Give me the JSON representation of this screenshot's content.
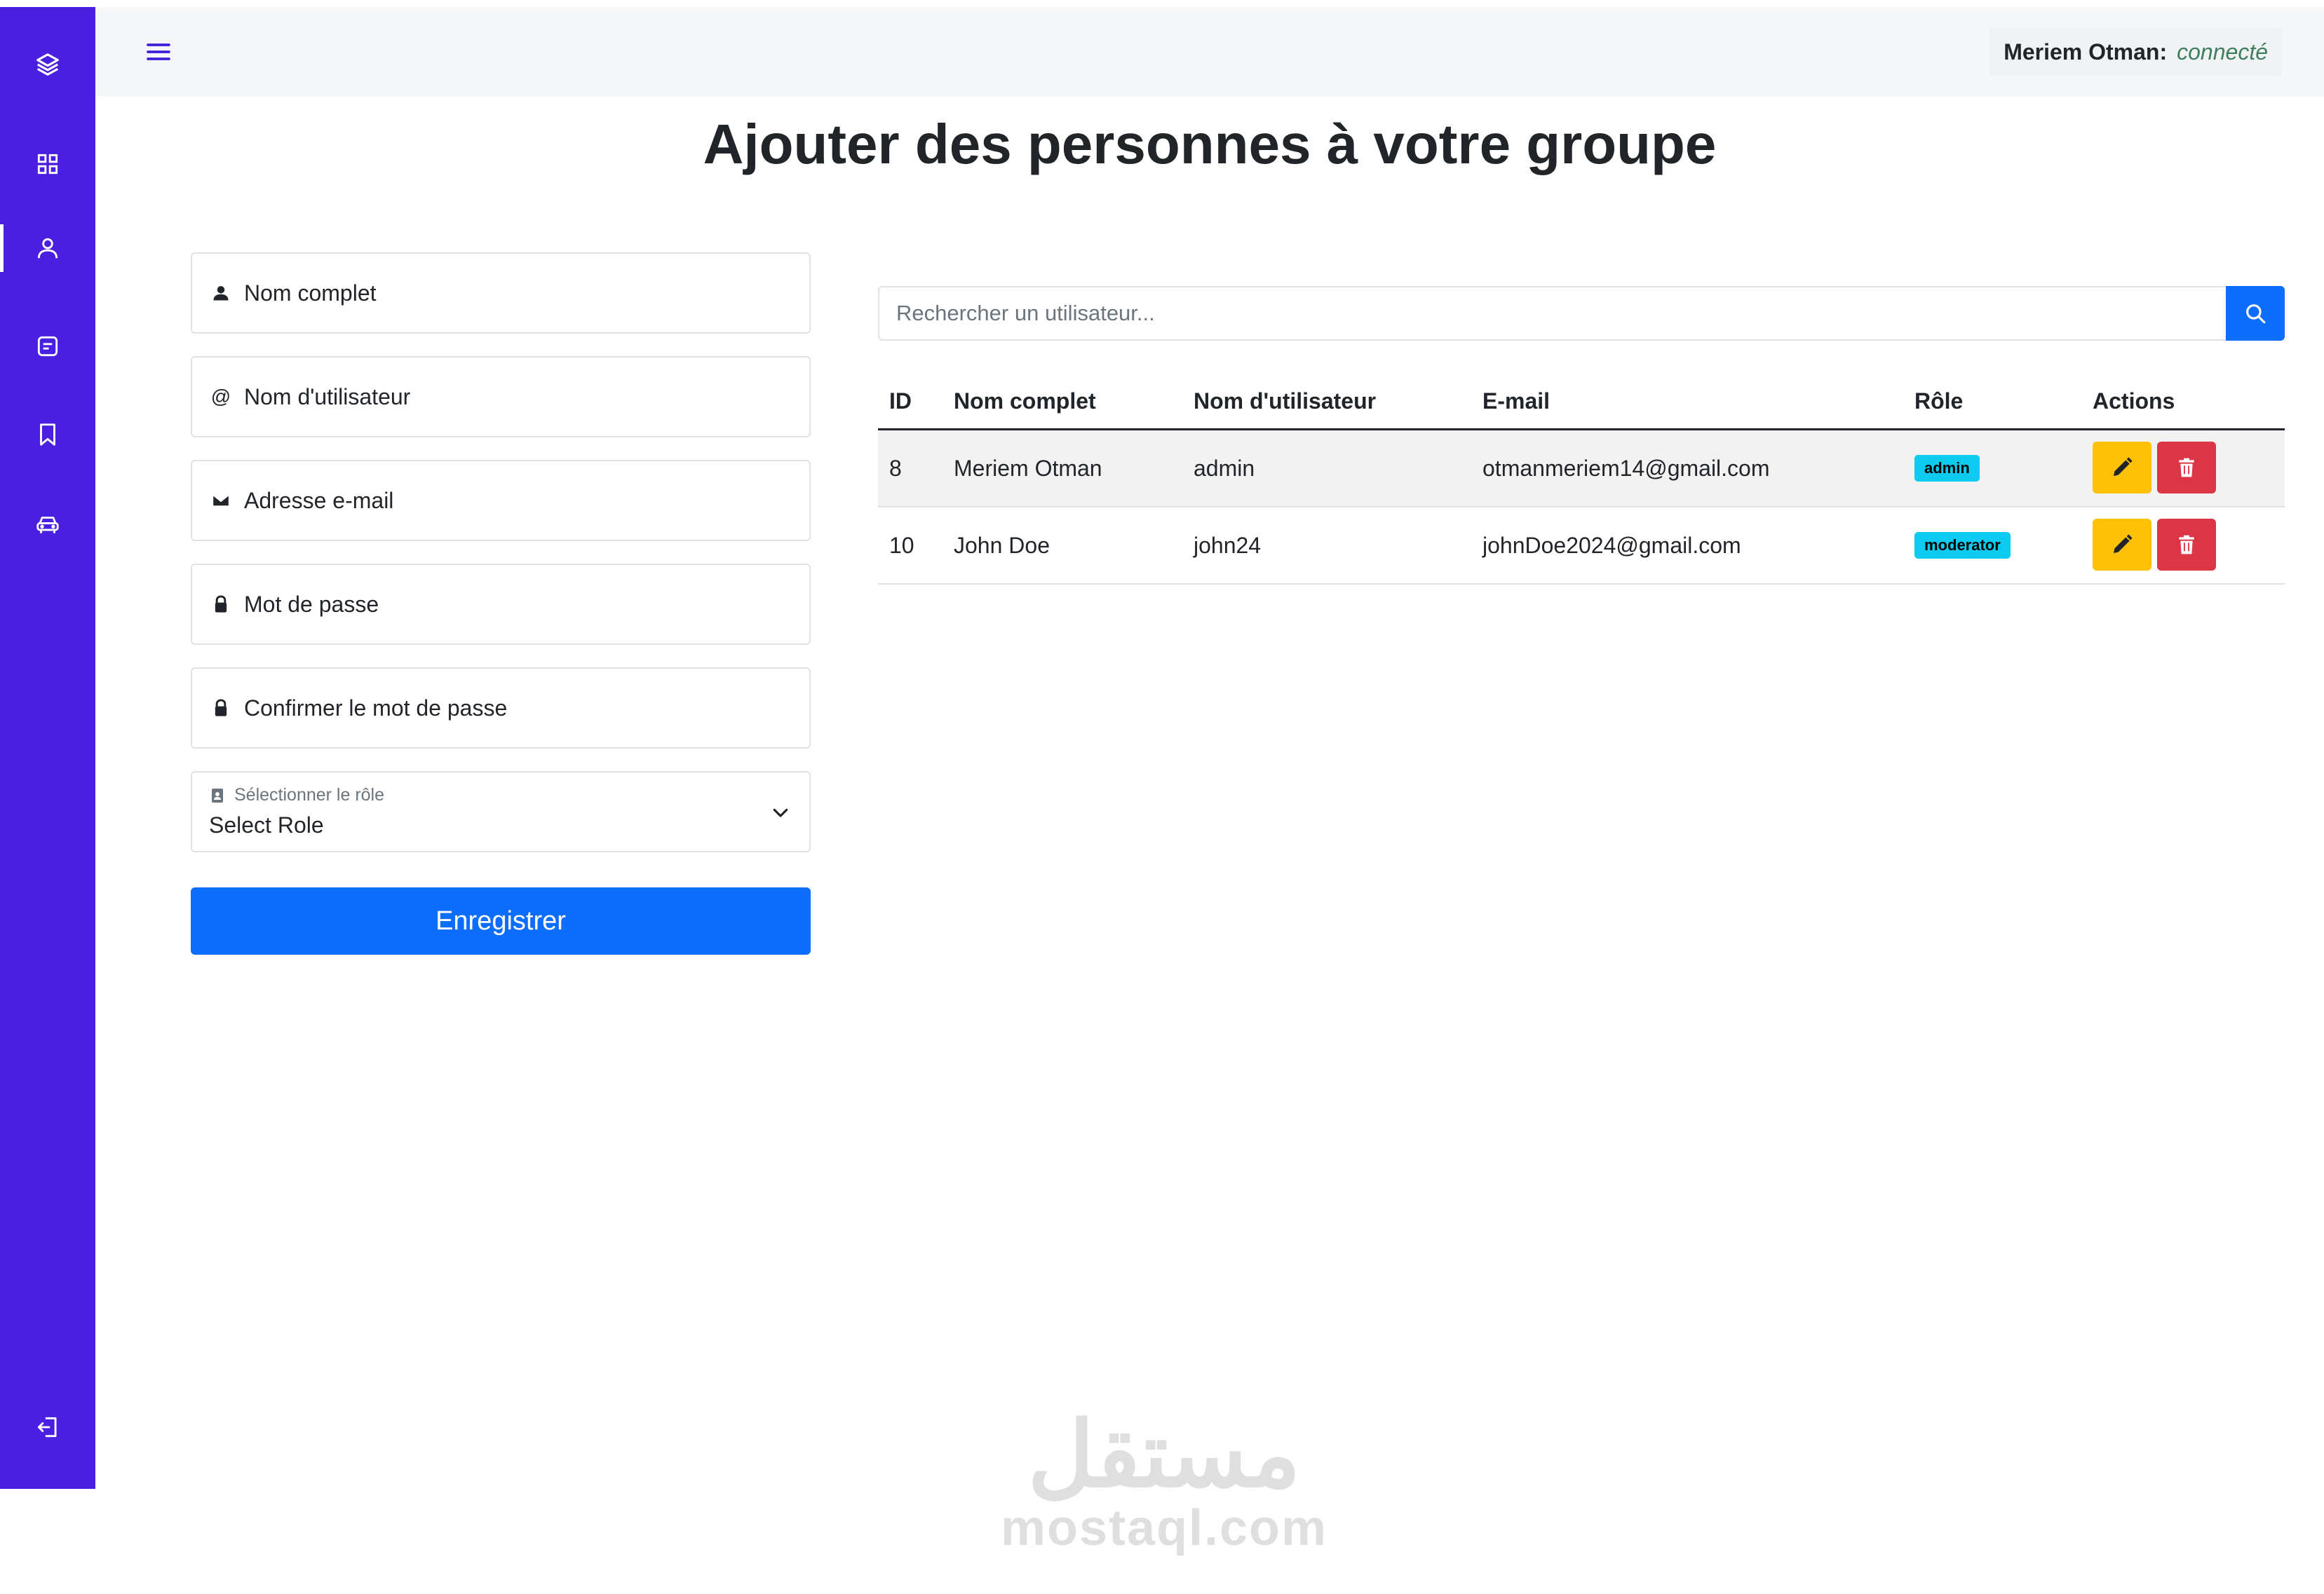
{
  "header": {
    "user_name": "Meriem Otman",
    "separator": ":",
    "status": "connecté"
  },
  "sidebar": {
    "items": [
      {
        "icon": "layers-icon"
      },
      {
        "icon": "grid-icon"
      },
      {
        "icon": "user-icon",
        "active": true
      },
      {
        "icon": "note-icon"
      },
      {
        "icon": "bookmark-icon"
      },
      {
        "icon": "car-icon"
      }
    ],
    "logout_icon": "logout-icon"
  },
  "page": {
    "title": "Ajouter des personnes à votre groupe"
  },
  "form": {
    "full_name": "Nom complet",
    "username": "Nom d'utilisateur",
    "username_icon": "@",
    "email": "Adresse e-mail",
    "password": "Mot de passe",
    "confirm_password": "Confirmer le mot de passe",
    "role_label": "Sélectionner le rôle",
    "role_value": "Select Role",
    "submit": "Enregistrer"
  },
  "search": {
    "placeholder": "Rechercher un utilisateur..."
  },
  "table": {
    "headers": [
      "ID",
      "Nom complet",
      "Nom d'utilisateur",
      "E-mail",
      "Rôle",
      "Actions"
    ],
    "rows": [
      {
        "id": "8",
        "full_name": "Meriem Otman",
        "username": "admin",
        "email": "otmanmeriem14@gmail.com",
        "role": "admin"
      },
      {
        "id": "10",
        "full_name": "John Doe",
        "username": "john24",
        "email": "johnDoe2024@gmail.com",
        "role": "moderator"
      }
    ]
  },
  "colors": {
    "sidebar": "#4a1fe0",
    "primary": "#0d6efd",
    "edit": "#ffc107",
    "delete": "#dc3545",
    "badge": "#0dcaf0",
    "status": "#3f7f5f"
  },
  "watermark": {
    "arabic": "مستقل",
    "latin": "mostaql.com"
  }
}
